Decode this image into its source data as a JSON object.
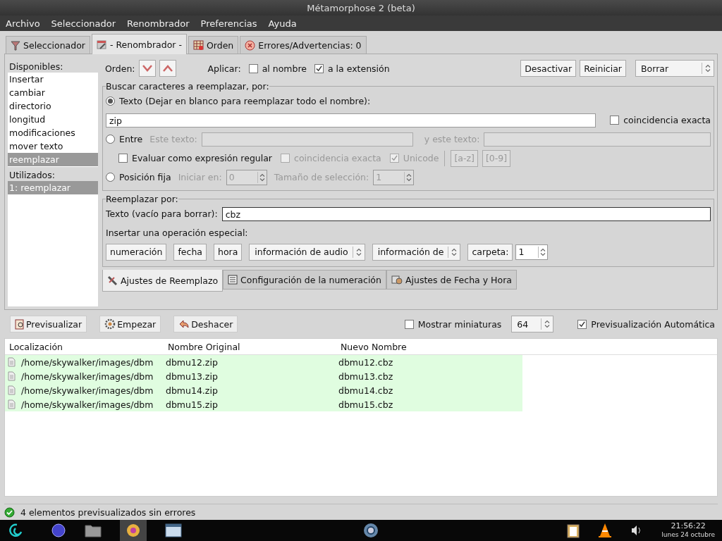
{
  "window": {
    "title": "Métamorphose 2 (beta)"
  },
  "menu": [
    "Archivo",
    "Seleccionador",
    "Renombrador",
    "Preferencias",
    "Ayuda"
  ],
  "main_tabs": [
    {
      "label": "Seleccionador",
      "selected": false
    },
    {
      "label": "- Renombrador -",
      "selected": true
    },
    {
      "label": "Orden",
      "selected": false
    },
    {
      "label": "Errores/Advertencias: 0",
      "selected": false
    }
  ],
  "sidebar": {
    "available_label": "Disponibles:",
    "available": [
      {
        "label": "Insertar",
        "selected": false
      },
      {
        "label": "cambiar",
        "selected": false
      },
      {
        "label": "directorio",
        "selected": false
      },
      {
        "label": "longitud",
        "selected": false
      },
      {
        "label": "modificaciones",
        "selected": false
      },
      {
        "label": "mover texto",
        "selected": false
      },
      {
        "label": "reemplazar",
        "selected": true
      }
    ],
    "used_label": "Utilizados:",
    "used": [
      {
        "label": "1: reemplazar",
        "selected": true
      }
    ]
  },
  "toolbar": {
    "order_label": "Orden:",
    "apply_label": "Aplicar:",
    "apply_options": [
      {
        "label": "al nombre",
        "checked": false
      },
      {
        "label": "a la extensión",
        "checked": true
      }
    ],
    "buttons": [
      "Desactivar",
      "Reiniciar"
    ],
    "mode": "Borrar"
  },
  "search": {
    "title": "Buscar caracteres a reemplazar, por:",
    "text_option": {
      "label": "Texto (Dejar en blanco para reemplazar todo el nombre):",
      "selected": true
    },
    "text_value": "zip",
    "exact": {
      "label": "coincidencia exacta",
      "checked": false
    },
    "between_option": {
      "label": "Entre",
      "selected": false
    },
    "between_from_label": "Este texto:",
    "between_to_label": "y este texto:",
    "between_disabled": true,
    "regex": {
      "label": "Evaluar como expresión regular",
      "checked": false
    },
    "regex_exact": {
      "label": "coincidencia exacta",
      "checked": false,
      "disabled": true
    },
    "unicode": {
      "label": "Unicode",
      "checked": true,
      "disabled": true
    },
    "range_buttons": [
      "[a-z]",
      "[0-9]"
    ],
    "position_option": {
      "label": "Posición fija",
      "selected": false
    },
    "start_label": "Iniciar en:",
    "start_value": "0",
    "size_label": "Tamaño de selección:",
    "size_value": "1",
    "position_disabled": true
  },
  "replace": {
    "title": "Reemplazar por:",
    "text_label": "Texto (vacío para borrar):",
    "text_value": "cbz",
    "special_label": "Insertar una operación especial:",
    "operations": [
      {
        "kind": "button",
        "label": "numeración"
      },
      {
        "kind": "button",
        "label": "fecha"
      },
      {
        "kind": "button",
        "label": "hora"
      },
      {
        "kind": "select",
        "label": "información de audio"
      },
      {
        "kind": "select",
        "label": "información de"
      },
      {
        "kind": "button",
        "label": "carpeta:"
      },
      {
        "kind": "spin",
        "label": "1"
      }
    ]
  },
  "sub_tabs": [
    {
      "label": "Ajustes de Reemplazo",
      "selected": true
    },
    {
      "label": "Configuración de la numeración",
      "selected": false
    },
    {
      "label": "Ajustes de Fecha y Hora",
      "selected": false
    }
  ],
  "actions": [
    "Previsualizar",
    "Empezar",
    "Deshacer"
  ],
  "thumbnails": {
    "label": "Mostrar miniaturas",
    "checked": false,
    "size": "64"
  },
  "auto_preview": {
    "label": "Previsualización Automática",
    "checked": true
  },
  "table": {
    "columns": [
      "Localización",
      "Nombre Original",
      "Nuevo Nombre"
    ],
    "rows": [
      [
        "/home/skywalker/images/dbm",
        "dbmu12.zip",
        "dbmu12.cbz"
      ],
      [
        "/home/skywalker/images/dbm",
        "dbmu13.zip",
        "dbmu13.cbz"
      ],
      [
        "/home/skywalker/images/dbm",
        "dbmu14.zip",
        "dbmu14.cbz"
      ],
      [
        "/home/skywalker/images/dbm",
        "dbmu15.zip",
        "dbmu15.cbz"
      ]
    ]
  },
  "status_bar": "4 elementos previsualizados sin errores",
  "taskbar": {
    "time": "21:56:22",
    "date": "lunes 24 octubre"
  }
}
